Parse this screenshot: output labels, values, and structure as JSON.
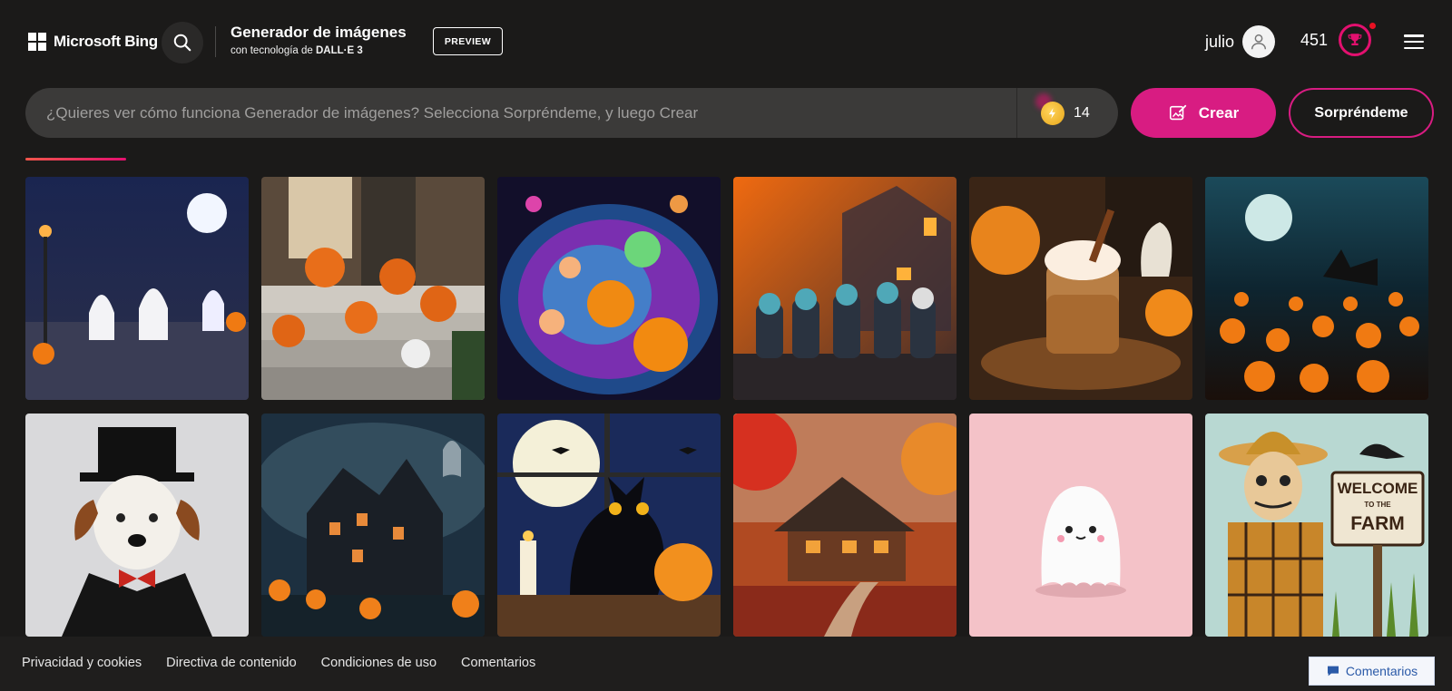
{
  "header": {
    "brand": "Microsoft Bing",
    "title": "Generador de imágenes",
    "subtitle_prefix": "con tecnología de",
    "subtitle_model": "DALL·E 3",
    "preview_badge": "PREVIEW",
    "user_name": "julio",
    "reward_points": "451",
    "icons": {
      "search": "search-icon",
      "avatar": "user-avatar-icon",
      "rewards": "trophy-icon",
      "menu": "hamburger-menu-icon"
    }
  },
  "prompt": {
    "placeholder": "¿Quieres ver cómo funciona Generador de imágenes? Selecciona Sorpréndeme, y luego Crear",
    "value": "",
    "boosts": "14",
    "create_label": "Crear",
    "surprise_label": "Sorpréndeme"
  },
  "gallery": {
    "tiles": [
      {
        "subject": "ghosts-street-night"
      },
      {
        "subject": "porch-pumpkins"
      },
      {
        "subject": "glowing-halloween-bowl"
      },
      {
        "subject": "kids-costumes-orange"
      },
      {
        "subject": "pumpkin-latte"
      },
      {
        "subject": "pumpkin-field-moon"
      },
      {
        "subject": "dog-vampire-tophat"
      },
      {
        "subject": "haunted-house"
      },
      {
        "subject": "black-cat-moon"
      },
      {
        "subject": "autumn-cabin"
      },
      {
        "subject": "cute-ghost-pink"
      },
      {
        "subject": "scarecrow-farm",
        "sign_text": [
          "WELCOME",
          "TO THE",
          "FARM"
        ]
      }
    ]
  },
  "footer": {
    "links": [
      "Privacidad y cookies",
      "Directiva de contenido",
      "Condiciones de uso",
      "Comentarios"
    ],
    "feedback_button": "Comentarios"
  },
  "colors": {
    "accent": "#d81c82",
    "background": "#1b1a19",
    "prompt_bg": "#3b3a39"
  }
}
